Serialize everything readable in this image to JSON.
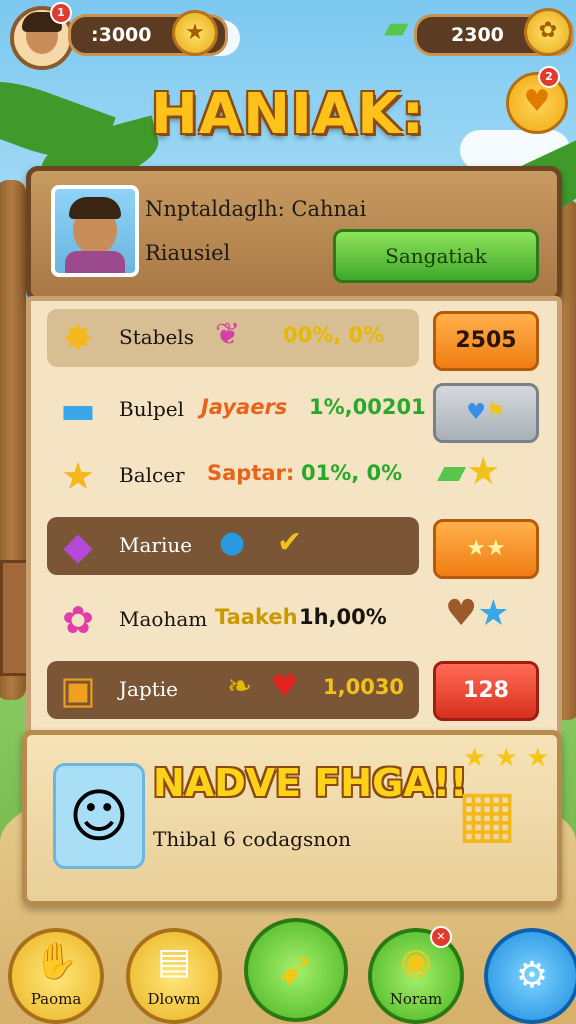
{
  "top_bar": {
    "left_currency": ":3000",
    "right_currency": "2300",
    "avatar_badge": "1",
    "heart_badge": "2"
  },
  "title": "HANIAK:",
  "profile": {
    "name": "Nnptaldaglh: Cahnai",
    "subtitle": "Riausiel",
    "button": "Sangatiak"
  },
  "rows": [
    {
      "label": "Stabels",
      "mid": "00%, 0%",
      "button": "2505",
      "mid_color": "#e6b800"
    },
    {
      "label": "Bulpel",
      "mid_a": "Jayaers",
      "mid": "1%,00201",
      "mid_color": "#2aa82a"
    },
    {
      "label": "Balcer",
      "mid_a": "Saptar:",
      "mid": "01%, 0%",
      "mid_color": "#2aa82a"
    },
    {
      "label": "Mariue"
    },
    {
      "label": "Maoham",
      "mid_a": "Taakeh",
      "mid": "1h,00%",
      "mid_color": "#1a1410"
    },
    {
      "label": "Japtie",
      "mid": "1,0030",
      "button": "128",
      "mid_color": "#e6b800"
    }
  ],
  "promo": {
    "title": "NADVE FHGA!!",
    "subtitle": "Thibal 6 codagsnon"
  },
  "nav": [
    {
      "label": "Paoma"
    },
    {
      "label": "Dlowm"
    },
    {
      "label": ""
    },
    {
      "label": "Noram"
    },
    {
      "label": ""
    }
  ],
  "colors": {
    "accent_gold": "#ffc21a",
    "wood": "#a97845",
    "green": "#3fa82a",
    "orange": "#ef7d13",
    "red": "#d8301f"
  }
}
